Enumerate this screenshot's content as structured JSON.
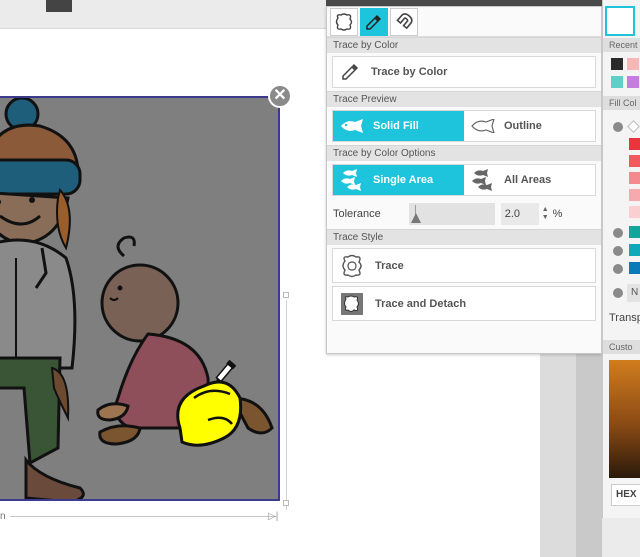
{
  "trace_panel": {
    "tabs": [
      {
        "name": "trace-tab",
        "icon": "trace-shape-icon"
      },
      {
        "name": "eyedropper-tab",
        "icon": "eyedropper-icon",
        "active": true
      },
      {
        "name": "magnet-tab",
        "icon": "magnet-icon"
      }
    ],
    "trace_by_color": {
      "header": "Trace by Color",
      "button_label": "Trace by Color"
    },
    "trace_preview": {
      "header": "Trace Preview",
      "solid_fill_label": "Solid Fill",
      "outline_label": "Outline",
      "selected": "Solid Fill"
    },
    "trace_options": {
      "header": "Trace by Color Options",
      "single_area_label": "Single Area",
      "all_areas_label": "All Areas",
      "selected": "Single Area"
    },
    "tolerance": {
      "label": "Tolerance",
      "value": "2.0",
      "unit": "%"
    },
    "trace_style": {
      "header": "Trace Style",
      "trace_label": "Trace",
      "trace_detach_label": "Trace and Detach"
    }
  },
  "fill_panel": {
    "recent_header": "Recent",
    "fill_header": "Fill Col",
    "none_label": "N",
    "transparency_label": "Transp",
    "custom_header": "Custo",
    "hex_label": "HEX"
  },
  "canvas": {
    "dimension_label": "n",
    "close_glyph": "✕"
  },
  "colors": {
    "accent": "#1ec3dc",
    "selection_border": "#3c3a8c",
    "image_bg": "#7f7f7f",
    "highlight_fill": "#ffff00"
  }
}
